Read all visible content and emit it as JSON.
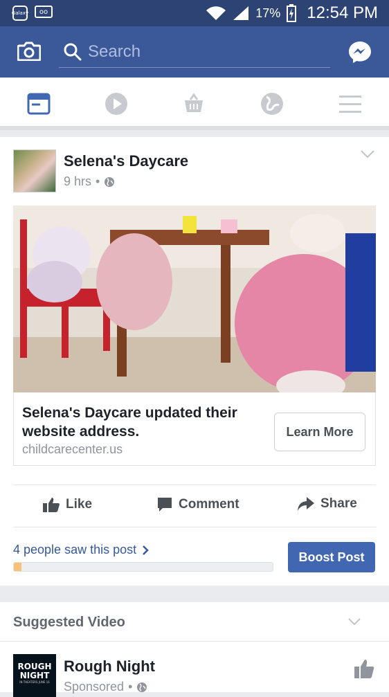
{
  "status_bar": {
    "left_icons": [
      "galaxy-app-icon",
      "voicemail-icon"
    ],
    "left_icon_texts": [
      "Galaxy",
      "oo"
    ],
    "battery": "17%",
    "time": "12:54 PM"
  },
  "top_bar": {
    "search_placeholder": "Search",
    "accent": "#3b5998"
  },
  "tabs": [
    {
      "name": "news-feed",
      "active": true
    },
    {
      "name": "videos",
      "active": false
    },
    {
      "name": "marketplace",
      "active": false
    },
    {
      "name": "notifications",
      "active": false
    },
    {
      "name": "menu",
      "active": false
    }
  ],
  "post": {
    "page_name": "Selena's Daycare",
    "time_ago": "9 hrs",
    "separator": "•",
    "link": {
      "title": "Selena's Daycare updated their website address.",
      "url": "childcarecenter.us",
      "button": "Learn More"
    },
    "actions": {
      "like": "Like",
      "comment": "Comment",
      "share": "Share"
    },
    "reach": {
      "text": "4 people saw this post",
      "progress_fraction": 0.03,
      "boost_label": "Boost Post"
    }
  },
  "suggested": {
    "title": "Suggested Video",
    "thumb_text": "ROUGH NIGHT",
    "thumb_sub": "IN THEATERS JUNE 16",
    "name": "Rough Night",
    "meta": "Sponsored",
    "separator": "•"
  }
}
